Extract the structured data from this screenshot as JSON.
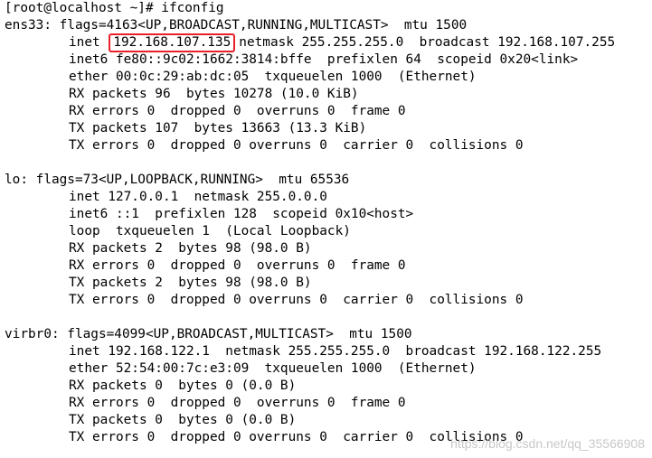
{
  "terminal": {
    "prompt": "[root@localhost ~]# ifconfig",
    "interfaces": [
      {
        "header": "ens33: flags=4163<UP,BROADCAST,RUNNING,MULTICAST>  mtu 1500",
        "inet_prefix": "inet",
        "inet_addr": "192.168.107.135",
        "inet_rest": "netmask 255.255.255.0  broadcast 192.168.107.255",
        "lines": [
          "inet6 fe80::9c02:1662:3814:bffe  prefixlen 64  scopeid 0x20<link>",
          "ether 00:0c:29:ab:dc:05  txqueuelen 1000  (Ethernet)",
          "RX packets 96  bytes 10278 (10.0 KiB)",
          "RX errors 0  dropped 0  overruns 0  frame 0",
          "TX packets 107  bytes 13663 (13.3 KiB)",
          "TX errors 0  dropped 0 overruns 0  carrier 0  collisions 0"
        ]
      },
      {
        "header": "lo: flags=73<UP,LOOPBACK,RUNNING>  mtu 65536",
        "lines": [
          "inet 127.0.0.1  netmask 255.0.0.0",
          "inet6 ::1  prefixlen 128  scopeid 0x10<host>",
          "loop  txqueuelen 1  (Local Loopback)",
          "RX packets 2  bytes 98 (98.0 B)",
          "RX errors 0  dropped 0  overruns 0  frame 0",
          "TX packets 2  bytes 98 (98.0 B)",
          "TX errors 0  dropped 0 overruns 0  carrier 0  collisions 0"
        ]
      },
      {
        "header": "virbr0: flags=4099<UP,BROADCAST,MULTICAST>  mtu 1500",
        "lines": [
          "inet 192.168.122.1  netmask 255.255.255.0  broadcast 192.168.122.255",
          "ether 52:54:00:7c:e3:09  txqueuelen 1000  (Ethernet)",
          "RX packets 0  bytes 0 (0.0 B)",
          "RX errors 0  dropped 0  overruns 0  frame 0",
          "TX packets 0  bytes 0 (0.0 B)",
          "TX errors 0  dropped 0 overruns 0  carrier 0  collisions 0"
        ]
      }
    ]
  },
  "watermark": "https://blog.csdn.net/qq_35566908",
  "colors": {
    "background": "#ffffff",
    "text": "#000000",
    "highlight_border": "#e8202a"
  }
}
